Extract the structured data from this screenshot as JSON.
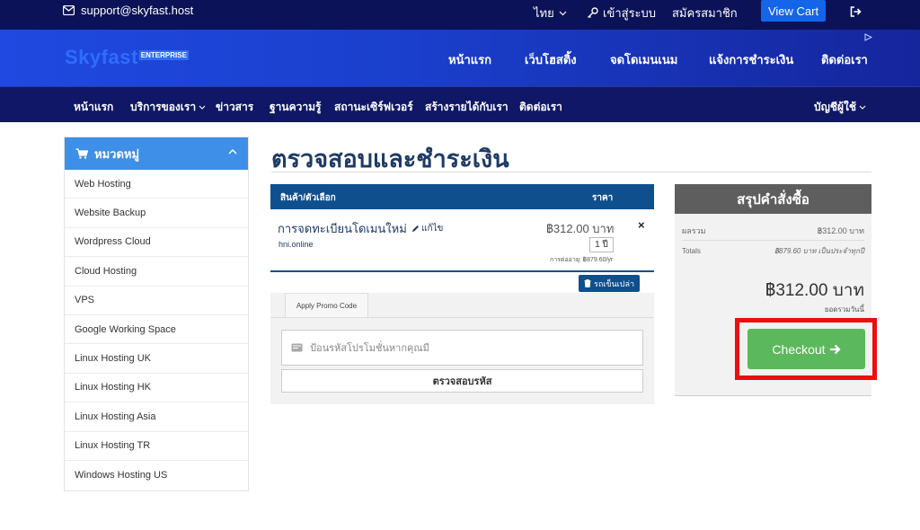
{
  "topbar": {
    "email": "support@skyfast.host",
    "language": "ไทย",
    "login": "เข้าสู่ระบบ",
    "register": "สมัครสมาชิก",
    "view_cart": "View Cart"
  },
  "header": {
    "logo_main": "Skyfast",
    "logo_badge": "ENTERPRISE",
    "nav": [
      "หน้าแรก",
      "เว็บโฮสติ้ง",
      "จดโดเมนเนม",
      "แจ้งการชำระเงิน",
      "ติดต่อเรา"
    ]
  },
  "subnav": {
    "items": [
      "หน้าแรก",
      "บริการของเรา",
      "ข่าวสาร",
      "ฐานความรู้",
      "สถานะเซิร์ฟเวอร์",
      "สร้างรายได้กับเรา",
      "ติดต่อเรา"
    ],
    "account": "บัญชีผู้ใช้"
  },
  "sidebar": {
    "title": "หมวดหมู่",
    "items": [
      "Web Hosting",
      "Website Backup",
      "Wordpress Cloud",
      "Cloud Hosting",
      "VPS",
      "Google Working Space",
      "Linux Hosting UK",
      "Linux Hosting HK",
      "Linux Hosting Asia",
      "Linux Hosting TR",
      "Windows Hosting US"
    ]
  },
  "page": {
    "title": "ตรวจสอบและชำระเงิน"
  },
  "cart": {
    "col_product": "สินค้า/ตัวเลือก",
    "col_price": "ราคา",
    "product_name": "การจดทะเบียนโดเมนใหม่",
    "edit_label": "แก้ไข",
    "domain": "hni.online",
    "price": "฿312.00 บาท",
    "qty": "1 ปี",
    "renewal": "การต่ออายุ: ฿879.60/yr",
    "empty_label": "รถเข็นเปล่า"
  },
  "promo": {
    "tab_label": "Apply Promo Code",
    "placeholder": "ป้อนรหัสโปรโมชั่นหากคุณมี",
    "button": "ตรวจสอบรหัส"
  },
  "summary": {
    "title": "สรุปคำสั่งซื้อ",
    "subtotal_label": "ผลรวม",
    "subtotal_value": "฿312.00 บาท",
    "totals_label": "Totals",
    "totals_value": "฿879.60 บาท เป็นประจำทุกปี",
    "total_price": "฿312.00 บาท",
    "total_note": "ยอดรวมวันนี้",
    "checkout_label": "Checkout"
  },
  "colors": {
    "topbar": "#0b1257",
    "brand_blue": "#1f49e0",
    "checkout_green": "#5cb85c",
    "highlight_red": "#ec0d0d"
  }
}
